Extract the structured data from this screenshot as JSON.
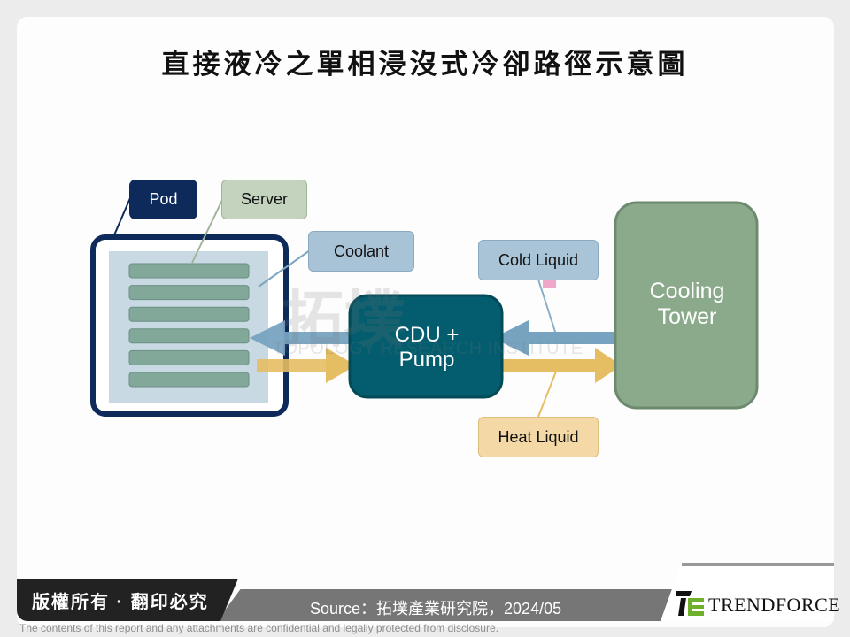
{
  "title": "直接液冷之單相浸沒式冷卻路徑示意圖",
  "labels": {
    "pod": "Pod",
    "server": "Server",
    "coolant": "Coolant",
    "cold_liquid": "Cold Liquid",
    "heat_liquid": "Heat Liquid"
  },
  "nodes": {
    "cdu": {
      "line1": "CDU +",
      "line2": "Pump"
    },
    "cooling_tower": {
      "line1": "Cooling",
      "line2": "Tower"
    }
  },
  "server_slots": 6,
  "flows": [
    {
      "name": "cold-flow-tower-to-cdu",
      "from": "Cooling Tower",
      "to": "CDU + Pump",
      "type": "cold"
    },
    {
      "name": "cold-flow-cdu-to-pod",
      "from": "CDU + Pump",
      "to": "Pod",
      "type": "cold"
    },
    {
      "name": "heat-flow-pod-to-cdu",
      "from": "Pod",
      "to": "CDU + Pump",
      "type": "heat"
    },
    {
      "name": "heat-flow-cdu-to-tower",
      "from": "CDU + Pump",
      "to": "Cooling Tower",
      "type": "heat"
    }
  ],
  "colors": {
    "pod_border": "#0e2a5a",
    "coolant_bg": "#c9d9e4",
    "server_bar": "#82a89a",
    "cdu": "#045d6e",
    "cooling_tower": "#8baa8b",
    "cold_arrow": "#77a3c0",
    "heat_arrow": "#e5bd62"
  },
  "watermark": {
    "cn": "拓墣",
    "en": "TOPOLOGY RESEARCH INSTITUTE"
  },
  "footer": {
    "copyright": "版權所有 · 翻印必究",
    "source": "Source：拓墣產業研究院，2024/05",
    "brand": "TRENDFORCE",
    "disclaimer": "The contents of this report and any attachments are confidential and legally protected from disclosure."
  }
}
